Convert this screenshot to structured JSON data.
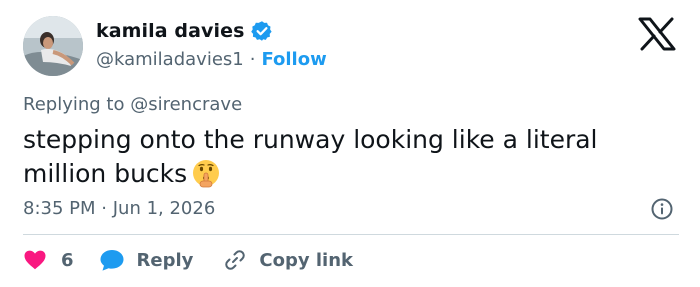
{
  "author": {
    "display_name": "kamila davies",
    "handle": "@kamiladavies1",
    "separator": "·",
    "follow_label": "Follow",
    "verified": true,
    "avatar_icon": "profile-photo"
  },
  "brand": {
    "logo_icon": "x-logo-icon"
  },
  "reply_context": {
    "prefix": "Replying to",
    "mention": "@sirencrave"
  },
  "tweet": {
    "text": "stepping onto the runway looking like a literal million bucks",
    "emoji_icon": "shushing-face-emoji"
  },
  "meta": {
    "time": "8:35 PM",
    "separator": "·",
    "date": "Jun 1, 2026",
    "info_icon": "info-icon"
  },
  "actions": {
    "like_count": "6",
    "reply_label": "Reply",
    "copy_link_label": "Copy link",
    "like_icon": "heart-icon",
    "reply_icon": "reply-bubble-icon",
    "copy_icon": "link-icon"
  },
  "colors": {
    "accent": "#1d9bf0",
    "like": "#f91880",
    "text": "#0f1419",
    "muted": "#536471",
    "divider": "#cfd9de"
  }
}
